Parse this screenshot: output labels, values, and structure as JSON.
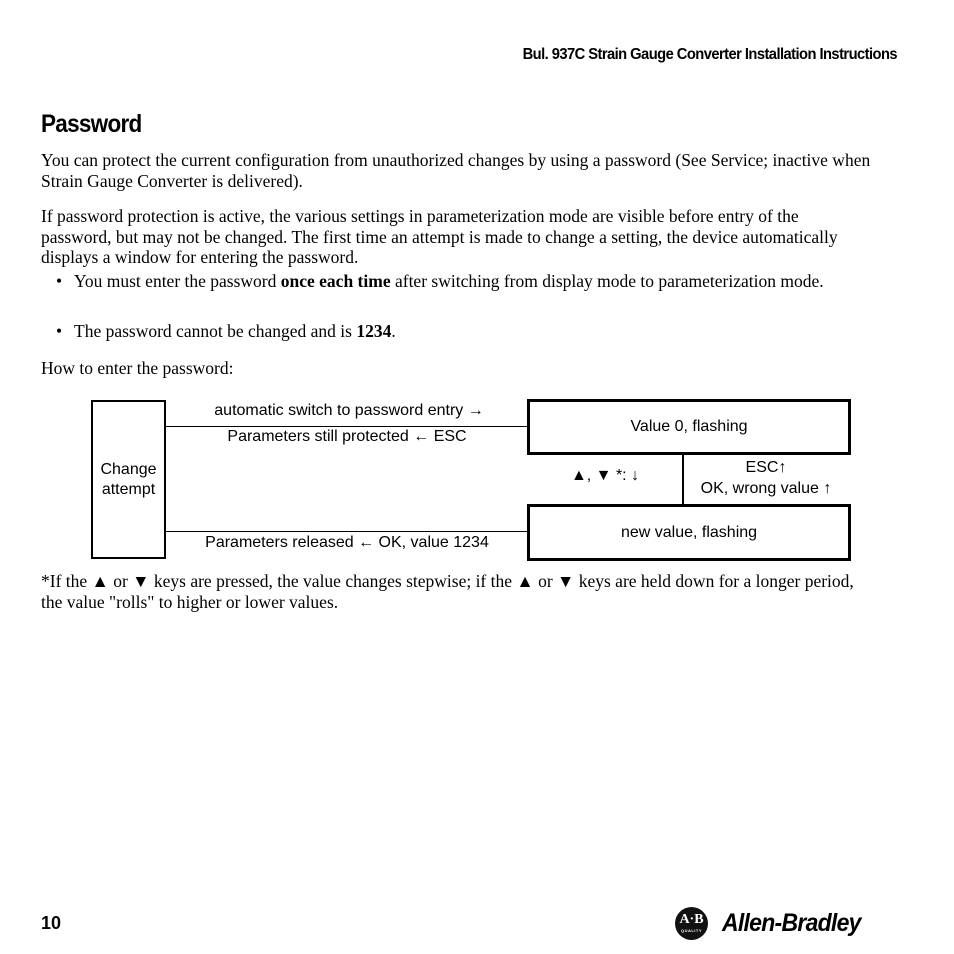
{
  "header": {
    "doc_title": "Bul. 937C Strain Gauge Converter Installation Instructions"
  },
  "section": {
    "title": "Password",
    "para1": "You can protect the current configuration from unauthorized changes by using a password (See Service; inactive when Strain Gauge Converter is delivered).",
    "para2": "If password protection is active, the various settings in parameterization mode are visible before entry of the password, but may not be changed. The first time an attempt is made to change a setting, the device automatically displays a window for entering the password.",
    "bullets": [
      {
        "before": "You must enter the password ",
        "bold": "once each time",
        "after": " after switching from display mode to parameterization mode."
      },
      {
        "before": "The password cannot be changed and is ",
        "bold": "1234",
        "after": "."
      }
    ],
    "how_to": "How to enter the password:",
    "footnote": "*If the ▲ or ▼ keys are pressed, the value changes stepwise; if the ▲ or ▼ keys are held down for a longer period, the value \"rolls\" to higher or lower values."
  },
  "diagram": {
    "change_attempt_line1": "Change",
    "change_attempt_line2": "attempt",
    "arrow_auto_switch": "automatic switch to password entry →",
    "arrow_still_protected": "Parameters still protected ←  ESC",
    "arrow_released": "Parameters released ←  OK, value 1234",
    "state_value0": "Value 0, flashing",
    "keys_label": "▲, ▼ *: ↓",
    "esc_label": "ESC↑",
    "wrong_value_label": "OK, wrong value ↑",
    "state_new_value": "new value, flashing"
  },
  "footer": {
    "page_number": "10",
    "logo_letters": "A·B",
    "logo_sub": "QUALITY",
    "brand_name": "Allen-Bradley"
  }
}
